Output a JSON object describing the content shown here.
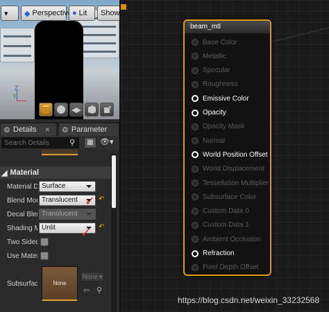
{
  "viewport": {
    "perspective_label": "Perspective",
    "lit_label": "Lit",
    "show_label": "Show",
    "axis_z": "Z",
    "axis_y": "Y"
  },
  "tabs": [
    {
      "label": "Details"
    },
    {
      "label": "Parameter"
    }
  ],
  "search": {
    "placeholder": "Search Details"
  },
  "material_section": {
    "title": "Material",
    "properties": [
      {
        "label": "Material Domain",
        "value": "Surface"
      },
      {
        "label": "Blend Mode",
        "value": "Translucent"
      },
      {
        "label": "Decal Blend Mode",
        "value": "Translucent"
      },
      {
        "label": "Shading Model",
        "value": "Unlit"
      },
      {
        "label": "Two Sided"
      },
      {
        "label": "Use Material Attributes"
      },
      {
        "label": "Subsurface Profile",
        "thumb_text": "None",
        "value": "None"
      }
    ]
  },
  "node": {
    "title": "beam_mtl",
    "pins": [
      {
        "label": "Base Color",
        "enabled": false
      },
      {
        "label": "Metallic",
        "enabled": false
      },
      {
        "label": "Specular",
        "enabled": false
      },
      {
        "label": "Roughness",
        "enabled": false
      },
      {
        "label": "Emissive Color",
        "enabled": true
      },
      {
        "label": "Opacity",
        "enabled": true
      },
      {
        "label": "Opacity Mask",
        "enabled": false
      },
      {
        "label": "Normal",
        "enabled": false
      },
      {
        "label": "World Position Offset",
        "enabled": true
      },
      {
        "label": "World Displacement",
        "enabled": false
      },
      {
        "label": "Tessellation Multiplier",
        "enabled": false
      },
      {
        "label": "Subsurface Color",
        "enabled": false
      },
      {
        "label": "Custom Data 0",
        "enabled": false
      },
      {
        "label": "Custom Data 1",
        "enabled": false
      },
      {
        "label": "Ambient Occlusion",
        "enabled": false
      },
      {
        "label": "Refraction",
        "enabled": true
      },
      {
        "label": "Pixel Depth Offset",
        "enabled": false
      }
    ]
  },
  "watermark": "https://blog.csdn.net/weixin_33232568",
  "colors": {
    "node_border": "#e09a10",
    "accent": "#e4b300",
    "annotation_tick": "#e02020"
  }
}
